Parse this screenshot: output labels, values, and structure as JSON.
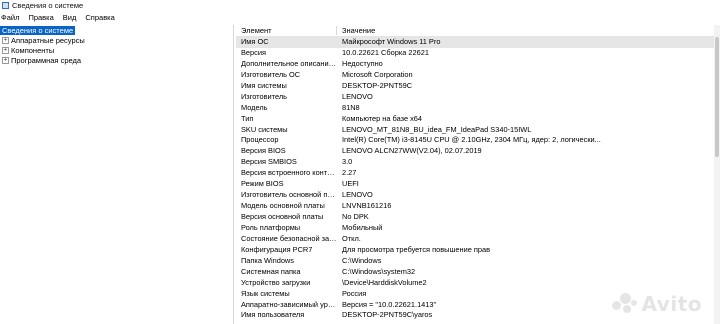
{
  "window": {
    "title": "Сведения о системе"
  },
  "menu": [
    "Файл",
    "Правка",
    "Вид",
    "Справка"
  ],
  "tree": {
    "root": "Сведения о системе",
    "children": [
      "Аппаратные ресурсы",
      "Компоненты",
      "Программная среда"
    ]
  },
  "table": {
    "columns": [
      "Элемент",
      "Значение"
    ],
    "rows": [
      [
        "Имя ОС",
        "Майкрософт Windows 11 Pro"
      ],
      [
        "Версия",
        "10.0.22621 Сборка 22621"
      ],
      [
        "Дополнительное описание ...",
        "Недоступно"
      ],
      [
        "Изготовитель ОС",
        "Microsoft Corporation"
      ],
      [
        "Имя системы",
        "DESKTOP-2PNT59C"
      ],
      [
        "Изготовитель",
        "LENOVO"
      ],
      [
        "Модель",
        "81N8"
      ],
      [
        "Тип",
        "Компьютер на базе x64"
      ],
      [
        "SKU системы",
        "LENOVO_MT_81N8_BU_idea_FM_IdeaPad S340-15IWL"
      ],
      [
        "Процессор",
        "Intel(R) Core(TM) i3-8145U CPU @ 2.10GHz, 2304 МГц, ядер: 2, логически..."
      ],
      [
        "Версия BIOS",
        "LENOVO ALCN27WW(V2.04), 02.07.2019"
      ],
      [
        "Версия SMBIOS",
        "3.0"
      ],
      [
        "Версия встроенного контрол...",
        "2.27"
      ],
      [
        "Режим BIOS",
        "UEFI"
      ],
      [
        "Изготовитель основной платы",
        "LENOVO"
      ],
      [
        "Модель основной платы",
        "LNVNB161216"
      ],
      [
        "Версия основной платы",
        "No DPK"
      ],
      [
        "Роль платформы",
        "Мобильный"
      ],
      [
        "Состояние безопасной загру...",
        "Откл."
      ],
      [
        "Конфигурация PCR7",
        "Для просмотра требуется повышение прав"
      ],
      [
        "Папка Windows",
        "C:\\Windows"
      ],
      [
        "Системная папка",
        "C:\\Windows\\system32"
      ],
      [
        "Устройство загрузки",
        "\\Device\\HarddiskVolume2"
      ],
      [
        "Язык системы",
        "Россия"
      ],
      [
        "Аппаратно-зависимый уров...",
        "Версия = \"10.0.22621.1413\""
      ],
      [
        "Имя пользователя",
        "DESKTOP-2PNT59C\\yaros"
      ]
    ]
  },
  "watermark": "Avito",
  "colors": {
    "selection": "#0a64c8",
    "selected_row": "#e6e6e6"
  }
}
